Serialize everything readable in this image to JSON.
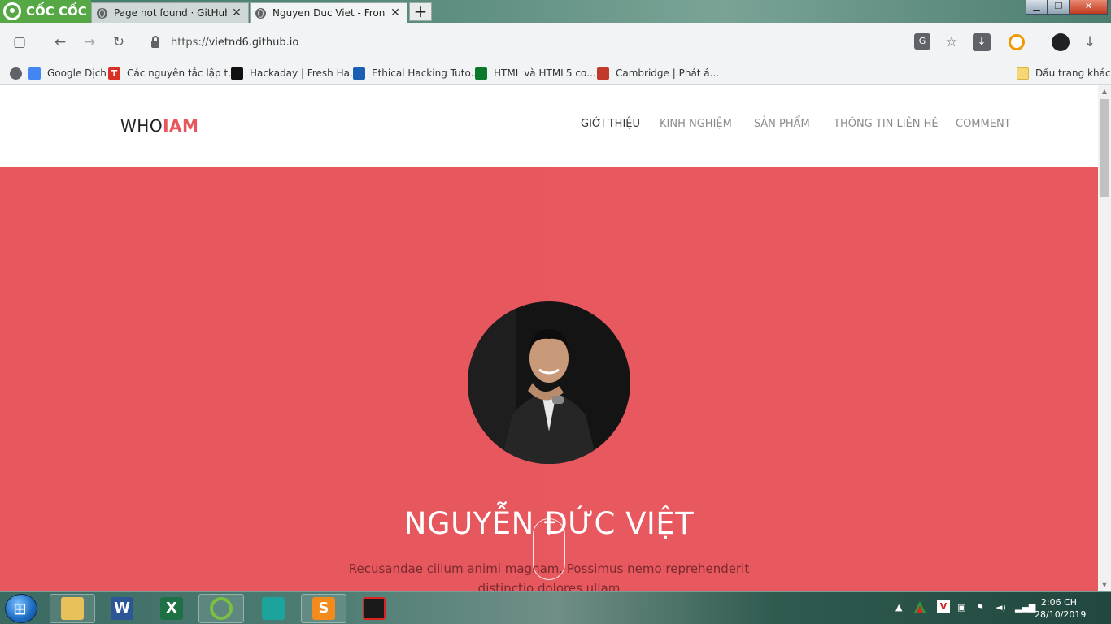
{
  "browser": {
    "brand": "CỐC CỐC",
    "tabs": [
      {
        "title": "Page not found · GitHub P",
        "active": false
      },
      {
        "title": "Nguyen Duc Viet - Fronte",
        "active": true
      }
    ],
    "new_tab_symbol": "+",
    "window_controls": {
      "minimize": "▁",
      "maximize": "❐",
      "close": "✕"
    },
    "toolbar": {
      "back": "←",
      "forward": "→",
      "reload": "↻",
      "sidebar": "▢",
      "star": "☆",
      "download": "↓"
    },
    "url": {
      "scheme": "https://",
      "host": "vietnd6.github.io"
    },
    "bookmarks": [
      {
        "label": "Google Dịch",
        "icon": "google-translate-icon",
        "color": "#4285f4"
      },
      {
        "label": "Các nguyên tắc lập t...",
        "icon": "t-icon",
        "color": "#d93025"
      },
      {
        "label": "Hackaday | Fresh Ha...",
        "icon": "hackaday-icon",
        "color": "#111111"
      },
      {
        "label": "Ethical Hacking Tuto...",
        "icon": "column-icon",
        "color": "#1a5fb4"
      },
      {
        "label": "HTML và HTML5 cơ...",
        "icon": "html-icon",
        "color": "#0a7a2a"
      },
      {
        "label": "Cambridge | Phát á...",
        "icon": "cambridge-shield-icon",
        "color": "#c0392b"
      }
    ],
    "other_bookmarks": "Dấu trang khác"
  },
  "site": {
    "logo": {
      "part1": "WHO",
      "part2": "IAM"
    },
    "accent_color": "#e6585e",
    "nav": [
      {
        "label": "GIỚI THIỆU",
        "active": true
      },
      {
        "label": "KINH NGHIỆM",
        "active": false
      },
      {
        "label": "SẢN PHẨM",
        "active": false
      },
      {
        "label": "THÔNG TIN LIÊN HỆ",
        "active": false
      },
      {
        "label": "COMMENT",
        "active": false
      }
    ],
    "hero": {
      "name": "NGUYỄN ĐỨC VIỆT",
      "subtitle": "Recusandae cillum animi magnam. Possimus nemo reprehenderit distinctio dolores ullam"
    }
  },
  "taskbar": {
    "apps": [
      {
        "name": "file-explorer",
        "glyph": ""
      },
      {
        "name": "word",
        "glyph": "W"
      },
      {
        "name": "excel",
        "glyph": "X"
      },
      {
        "name": "coccoc",
        "glyph": ""
      },
      {
        "name": "vscode",
        "glyph": ""
      },
      {
        "name": "sublime",
        "glyph": "S"
      },
      {
        "name": "garena",
        "glyph": ""
      }
    ],
    "clock": {
      "time": "2:06 CH",
      "date": "28/10/2019"
    }
  }
}
